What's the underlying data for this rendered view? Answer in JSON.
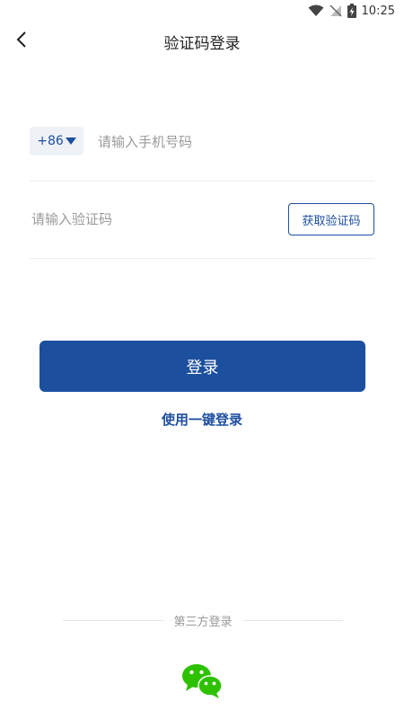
{
  "status_bar": {
    "time": "10:25"
  },
  "nav": {
    "title": "验证码登录",
    "back_icon": "chevron-left-icon"
  },
  "phone_row": {
    "country_code": "+86",
    "placeholder": "请输入手机号码",
    "value": ""
  },
  "code_row": {
    "placeholder": "请输入验证码",
    "value": "",
    "get_code_label": "获取验证码"
  },
  "login_button_label": "登录",
  "one_click_login_label": "使用一键登录",
  "third_party": {
    "divider_text": "第三方登录",
    "wechat_icon": "wechat-icon"
  },
  "colors": {
    "primary": "#1c4f9e",
    "link": "#1e4fa0",
    "wechat_green": "#2dc100"
  }
}
